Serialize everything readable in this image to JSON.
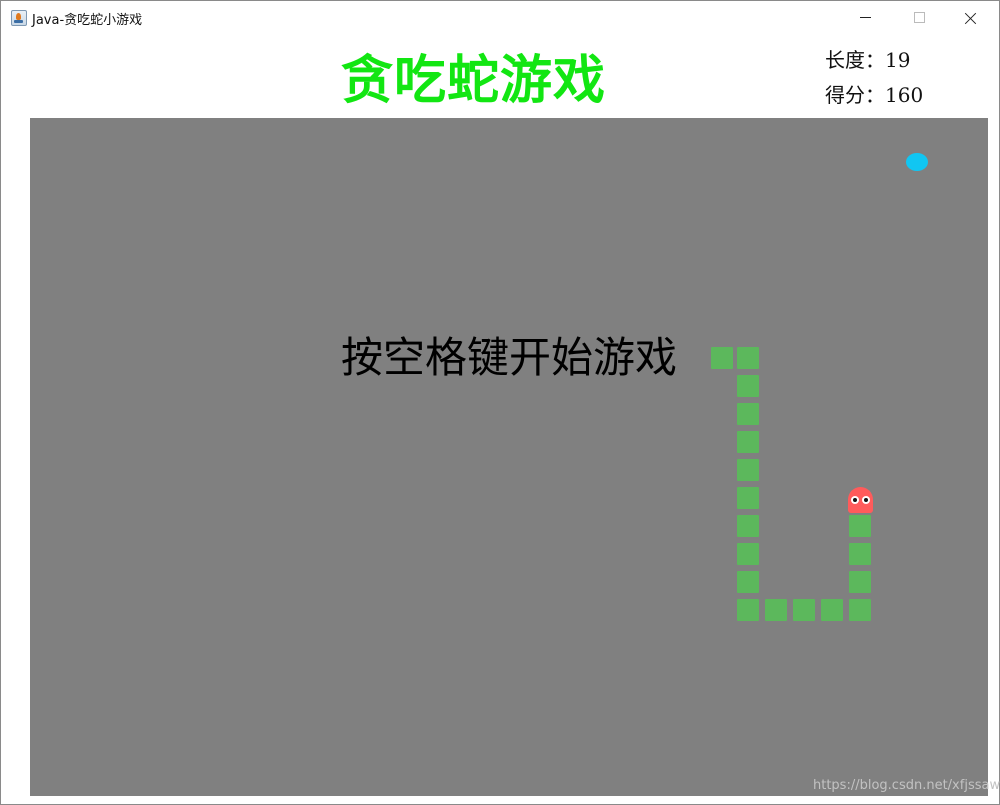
{
  "window": {
    "title": "Java-贪吃蛇小游戏"
  },
  "game": {
    "title": "贪吃蛇游戏",
    "length_label": "长度：",
    "length_value": "19",
    "score_label": "得分：",
    "score_value": "160",
    "prompt": "按空格键开始游戏",
    "watermark": "https://blog.csdn.net/xfjssaw"
  },
  "colors": {
    "title": "#12e612",
    "board": "#808080",
    "snake_body": "#5cb85c",
    "snake_head": "#ff5b5b",
    "food": "#11c6f2"
  },
  "icons": {
    "app": "java-cup-icon",
    "minimize": "minimize-icon",
    "maximize": "maximize-icon",
    "close": "close-icon"
  }
}
